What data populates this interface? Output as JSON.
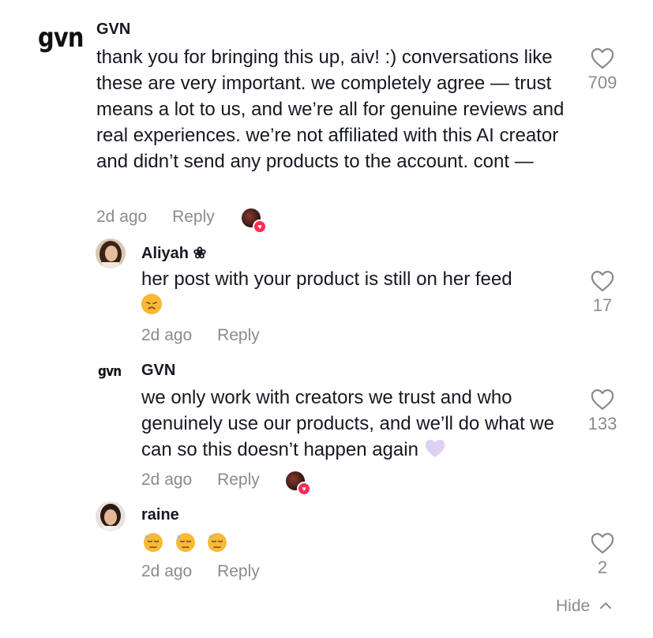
{
  "comments": [
    {
      "avatar_text": "gvn",
      "username": "GVN",
      "text": "thank you for bringing this up, aiv! :) conversations like these are very important. we completely agree — trust means a lot to us, and we’re all for genuine reviews and real experiences. we’re not affiliated with this AI creator and didn’t send any products to the account. cont —",
      "time": "2d ago",
      "reply_label": "Reply",
      "likes": "709"
    }
  ],
  "replies": [
    {
      "username": "Aliyah ❀",
      "text": "her post with your product is still on her feed",
      "emoji": "sad-face",
      "time": "2d ago",
      "reply_label": "Reply",
      "likes": "17"
    },
    {
      "avatar_text": "gvn",
      "username": "GVN",
      "text": "we only work with creators we trust and who genuinely use our products, and we’ll do what we can so this doesn’t happen again",
      "emoji": "light-purple-heart",
      "time": "2d ago",
      "reply_label": "Reply",
      "likes": "133"
    },
    {
      "username": "raine",
      "emoji": "sweat-face x3",
      "time": "2d ago",
      "reply_label": "Reply",
      "likes": "2"
    }
  ],
  "hide_label": "Hide",
  "colors": {
    "text": "#161823",
    "muted": "#8a8b91",
    "heart_badge": "#fe2c55"
  }
}
